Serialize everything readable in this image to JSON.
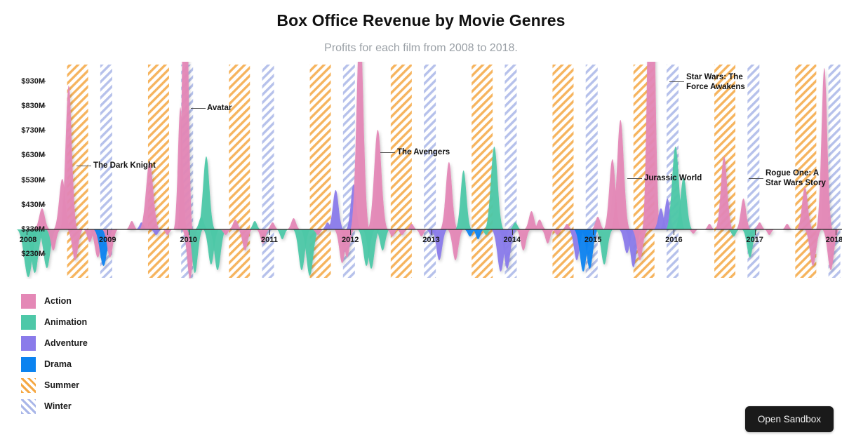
{
  "header": {
    "title": "Box Office Revenue by Movie Genres",
    "subtitle": "Profits for each film from 2008 to 2018."
  },
  "footer": {
    "sandbox_label": "Open Sandbox"
  },
  "legend": {
    "items": [
      {
        "label": "Action",
        "color": "#e488b6",
        "pattern": "solid"
      },
      {
        "label": "Animation",
        "color": "#4ec8a8",
        "pattern": "solid"
      },
      {
        "label": "Adventure",
        "color": "#8a7bea",
        "pattern": "solid"
      },
      {
        "label": "Drama",
        "color": "#0b83f0",
        "pattern": "solid"
      },
      {
        "label": "Summer",
        "color": "#f5a742",
        "pattern": "hatch"
      },
      {
        "label": "Winter",
        "color": "#a9b6e8",
        "pattern": "hatch"
      }
    ]
  },
  "chart_data": {
    "type": "area",
    "title": "Box Office Revenue by Movie Genres",
    "subtitle": "Profits for each film from 2008 to 2018.",
    "xlabel": "",
    "ylabel": "",
    "grid": false,
    "legend_position": "bottom-left",
    "baseline_value": 330,
    "yaxis": {
      "ticks": [
        "$930M",
        "$830M",
        "$730M",
        "$630M",
        "$530M",
        "$430M",
        "$330M",
        "$230M"
      ],
      "tick_values": [
        930,
        830,
        730,
        630,
        530,
        430,
        330,
        230
      ],
      "ylim": [
        230,
        980
      ],
      "unit": "M"
    },
    "xaxis": {
      "ticks": [
        "2008",
        "2009",
        "2010",
        "2011",
        "2012",
        "2013",
        "2014",
        "2015",
        "2016",
        "2017",
        "2018"
      ],
      "xlim": [
        2008,
        2018
      ]
    },
    "series": [
      {
        "name": "Action",
        "color": "#e488b6"
      },
      {
        "name": "Animation",
        "color": "#4ec8a8"
      },
      {
        "name": "Adventure",
        "color": "#8a7bea"
      },
      {
        "name": "Drama",
        "color": "#0b83f0"
      }
    ],
    "bands": [
      {
        "name": "Summer",
        "color": "#f5a742",
        "pattern": "hatch"
      },
      {
        "name": "Winter",
        "color": "#a9b6e8",
        "pattern": "hatch"
      }
    ],
    "annotations": [
      {
        "label": "The Dark Knight",
        "value": 533,
        "year": 2008.5
      },
      {
        "label": "Avatar",
        "value": 830,
        "year": 2009.9
      },
      {
        "label": "The Avengers",
        "value": 623,
        "year": 2012.1
      },
      {
        "label": "Jurassic World",
        "value": 530,
        "year": 2015.4
      },
      {
        "label": "Star Wars: The Force Awakens",
        "value": 936,
        "year": 2015.9
      },
      {
        "label": "Rogue One: A Star Wars Story",
        "value": 522,
        "year": 2016.9
      }
    ],
    "films": [
      {
        "label": "The Dark Knight",
        "genre": "Action",
        "value": 533
      },
      {
        "label": "Avatar",
        "genre": "Action",
        "value": 830
      },
      {
        "label": "The Avengers",
        "genre": "Action",
        "value": 623
      },
      {
        "label": "Jurassic World",
        "genre": "Action",
        "value": 530
      },
      {
        "label": "Star Wars: The Force Awakens",
        "genre": "Action",
        "value": 936
      },
      {
        "label": "Rogue One: A Star Wars Story",
        "genre": "Action",
        "value": 522
      }
    ]
  }
}
